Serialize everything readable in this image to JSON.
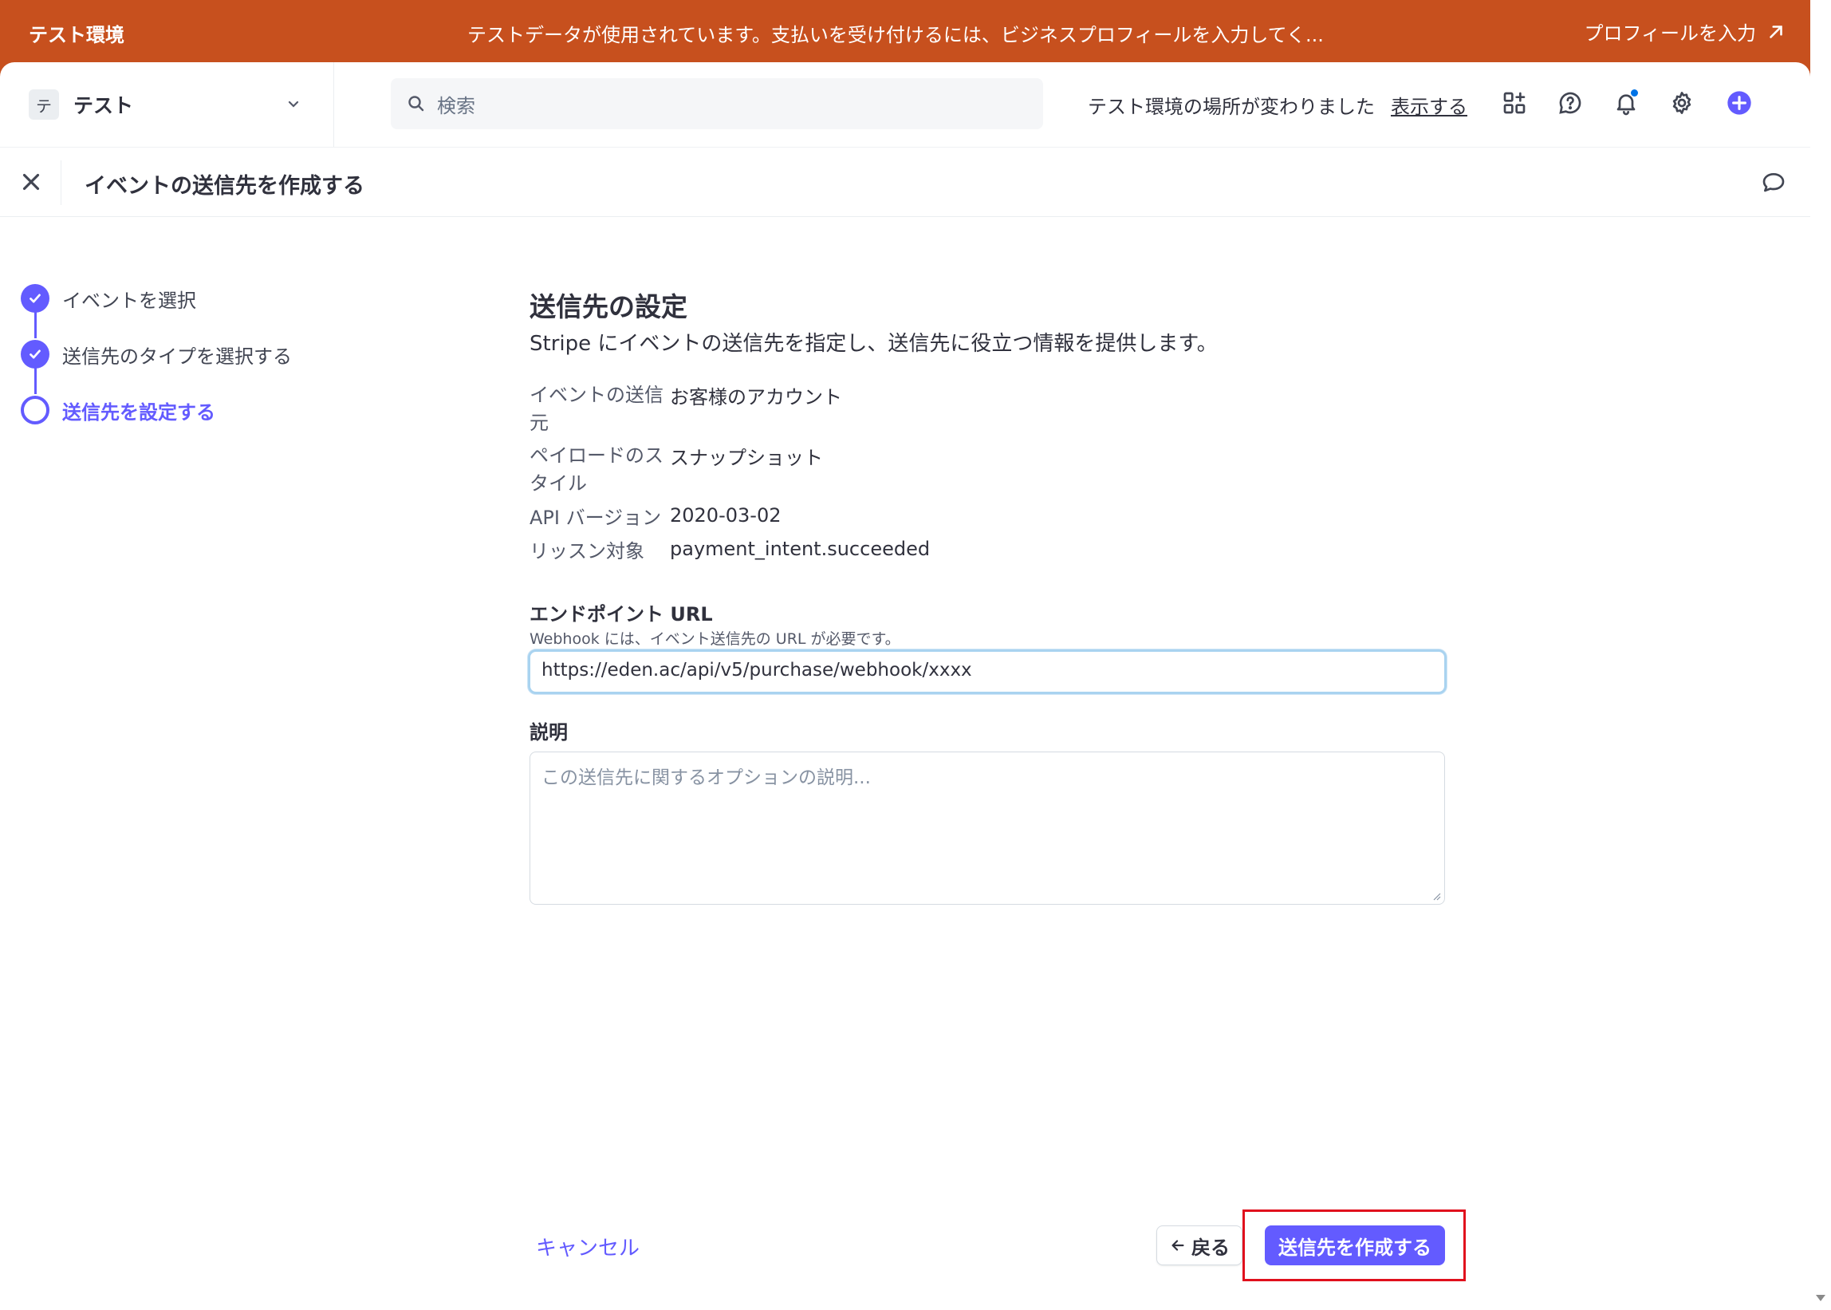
{
  "banner": {
    "title": "テスト環境",
    "message": "テストデータが使用されています。支払いを受け付けるには、ビジネスプロフィールを入力してく...",
    "link_label": "プロフィールを入力"
  },
  "header": {
    "account_initial": "テ",
    "account_name": "テスト",
    "search_placeholder": "検索",
    "env_note": "テスト環境の場所が変わりました",
    "env_link": "表示する"
  },
  "subheader": {
    "title": "イベントの送信先を作成する"
  },
  "steps": [
    {
      "label": "イベントを選択",
      "state": "done"
    },
    {
      "label": "送信先のタイプを選択する",
      "state": "done"
    },
    {
      "label": "送信先を設定する",
      "state": "current"
    }
  ],
  "form": {
    "title": "送信先の設定",
    "subtitle": "Stripe にイベントの送信先を指定し、送信先に役立つ情報を提供します。",
    "details": [
      {
        "label": "イベントの送信元",
        "value": "お客様のアカウント"
      },
      {
        "label": "ペイロードのスタイル",
        "value": "スナップショット"
      },
      {
        "label": "API バージョン",
        "value": "2020-03-02"
      },
      {
        "label": "リッスン対象",
        "value": "payment_intent.succeeded"
      }
    ],
    "endpoint_label": "エンドポイント URL",
    "endpoint_help": "Webhook には、イベント送信先の URL が必要です。",
    "endpoint_value": "https://eden.ac/api/v5/purchase/webhook/xxxx",
    "description_label": "説明",
    "description_placeholder": "この送信先に関するオプションの説明..."
  },
  "actions": {
    "cancel": "キャンセル",
    "back": "戻る",
    "create": "送信先を作成する"
  },
  "colors": {
    "banner": "#c7501e",
    "accent": "#635bff",
    "highlight": "#e0101d"
  }
}
